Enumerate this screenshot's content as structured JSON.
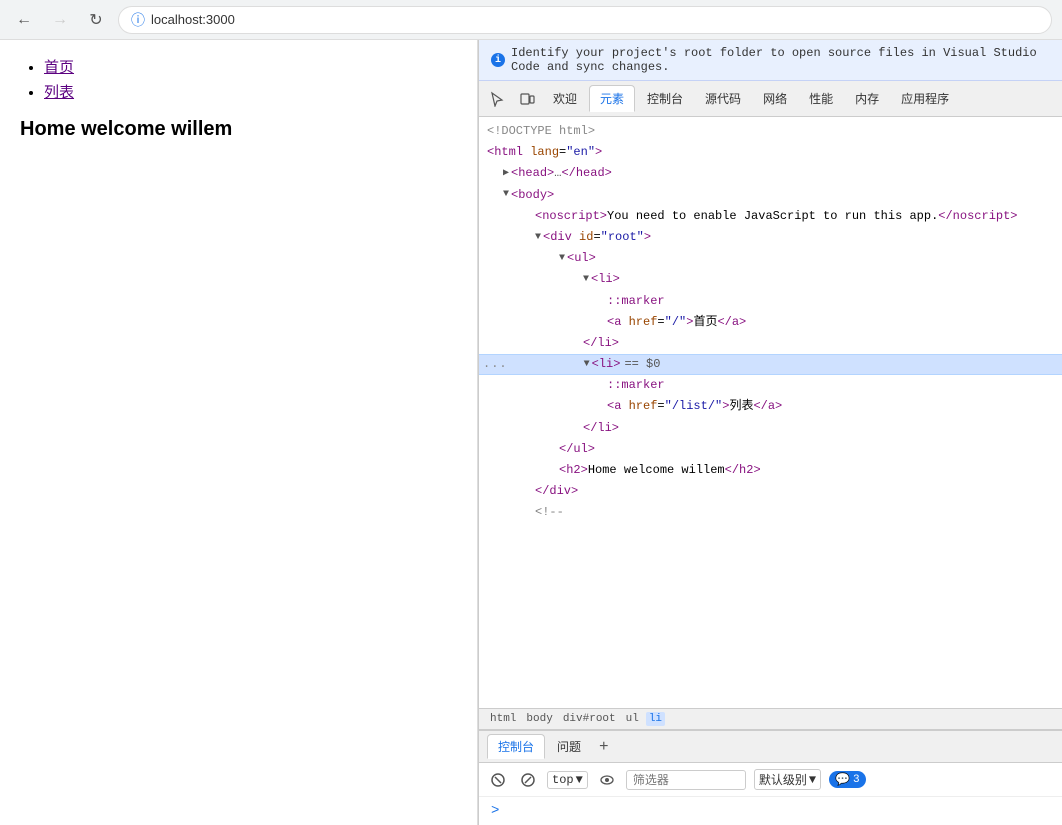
{
  "browser": {
    "url": "localhost:3000",
    "back_disabled": false,
    "forward_disabled": true
  },
  "webpage": {
    "nav_items": [
      {
        "label": "首页",
        "href": "/"
      },
      {
        "label": "列表",
        "href": "/list/"
      }
    ],
    "heading": "Home welcome willem"
  },
  "devtools": {
    "info_banner": "Identify your project's root folder to open source files in Visual Studio Code and sync changes.",
    "tabs": [
      {
        "label": "☰",
        "icon": true
      },
      {
        "label": "⧉",
        "icon": true
      },
      {
        "label": "欢迎"
      },
      {
        "label": "元素",
        "active": true
      },
      {
        "label": "控制台"
      },
      {
        "label": "源代码"
      },
      {
        "label": "网络"
      },
      {
        "label": "性能"
      },
      {
        "label": "内存"
      },
      {
        "label": "应用程序"
      }
    ],
    "dom": [
      {
        "indent": 0,
        "content": "<!DOCTYPE html>",
        "type": "doctype"
      },
      {
        "indent": 0,
        "content": "<html lang=\"en\">",
        "type": "tag-open"
      },
      {
        "indent": 1,
        "triangle": "▶",
        "content": "<head>…</head>",
        "type": "collapsed"
      },
      {
        "indent": 1,
        "triangle": "▼",
        "content": "<body>",
        "type": "tag-open"
      },
      {
        "indent": 2,
        "content": "<noscript>You need to enable JavaScript to run this app.</noscript>",
        "type": "noscript"
      },
      {
        "indent": 2,
        "triangle": "▼",
        "content": "<div id=\"root\">",
        "type": "tag-open"
      },
      {
        "indent": 3,
        "triangle": "▼",
        "content": "<ul>",
        "type": "tag-open"
      },
      {
        "indent": 4,
        "triangle": "▼",
        "content": "<li>",
        "type": "tag-open",
        "selected": false
      },
      {
        "indent": 5,
        "content": "::marker",
        "type": "pseudo"
      },
      {
        "indent": 5,
        "content": "<a href=\"/\">首页</a>",
        "type": "anchor"
      },
      {
        "indent": 4,
        "content": "</li>",
        "type": "tag-close"
      },
      {
        "indent": 4,
        "triangle": "▼",
        "content": "<li>",
        "type": "tag-open",
        "selected": true,
        "equals": "== $0"
      },
      {
        "indent": 5,
        "content": "::marker",
        "type": "pseudo"
      },
      {
        "indent": 5,
        "content": "<a href=\"/list/\">列表</a>",
        "type": "anchor"
      },
      {
        "indent": 4,
        "content": "</li>",
        "type": "tag-close"
      },
      {
        "indent": 3,
        "content": "</ul>",
        "type": "tag-close"
      },
      {
        "indent": 3,
        "content": "<h2>Home welcome willem</h2>",
        "type": "h2"
      },
      {
        "indent": 2,
        "content": "</div>",
        "type": "tag-close"
      },
      {
        "indent": 2,
        "content": "<!--",
        "type": "comment"
      }
    ],
    "breadcrumbs": [
      "html",
      "body",
      "div#root",
      "ul",
      "li"
    ],
    "bottom_tabs": [
      "控制台",
      "问题"
    ],
    "active_bottom_tab": "控制台",
    "console": {
      "top_label": "top",
      "filter_placeholder": "筛选器",
      "level_label": "默认级别",
      "error_count": "3"
    }
  }
}
